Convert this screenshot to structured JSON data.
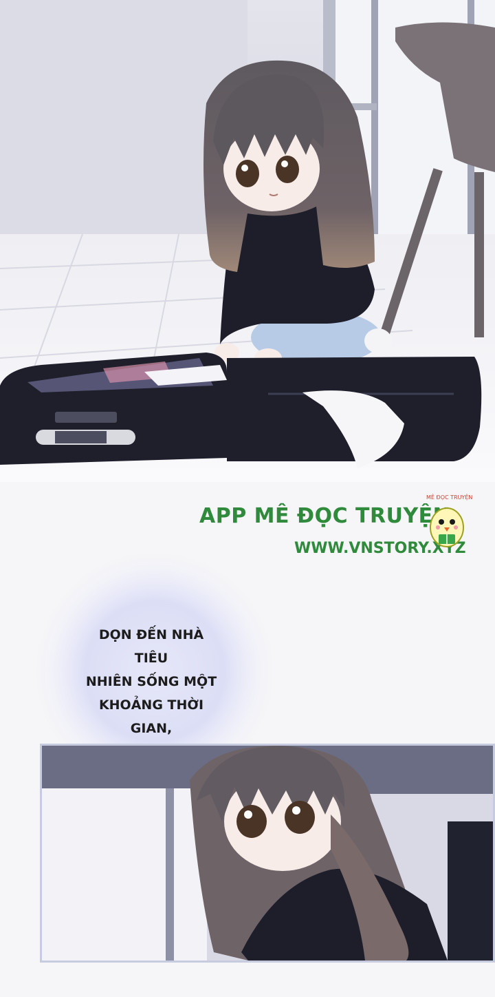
{
  "watermark": {
    "app_name": "APP MÊ ĐỌC TRUYỆN",
    "url": "WWW.VNSTORY.XYZ",
    "mascot_label": "MÊ ĐỌC TRUYỆN",
    "accent_color": "#2f8a3c"
  },
  "narration": {
    "lines": [
      "DỌN ĐẾN NHÀ TIÊU",
      "NHIÊN SỐNG MỘT",
      "KHOẢNG THỜI",
      "GIAN,"
    ]
  },
  "panels": {
    "top": "manga-panel-girl-unpacking-suitcase",
    "bottom": "manga-panel-girl-close-up"
  }
}
